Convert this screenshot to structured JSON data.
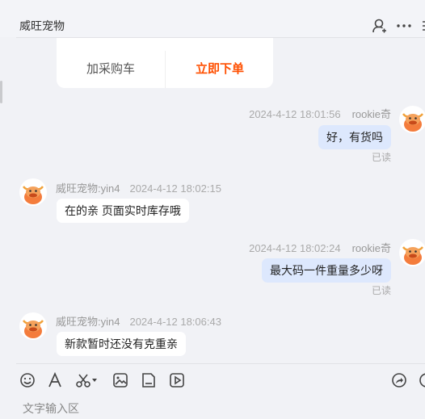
{
  "header": {
    "title": "威旺宠物"
  },
  "product_card": {
    "add_cart_label": "加采购车",
    "buy_label": "立即下单"
  },
  "messages": [
    {
      "sender": "rookie奇",
      "time": "2024-4-12 18:01:56",
      "text": "好，有货吗",
      "status": "已读"
    },
    {
      "sender": "威旺宠物:yin4",
      "time": "2024-4-12 18:02:15",
      "text": "在的亲 页面实时库存哦"
    },
    {
      "sender": "rookie奇",
      "time": "2024-4-12 18:02:24",
      "text": "最大码一件重量多少呀",
      "status": "已读"
    },
    {
      "sender": "威旺宠物:yin4",
      "time": "2024-4-12 18:06:43",
      "text": "新款暂时还没有克重亲"
    }
  ],
  "input": {
    "placeholder": "文字输入区"
  },
  "colors": {
    "accent": "#ff4f00",
    "bubble_out": "#dde8fd",
    "background": "#f1f2f6"
  }
}
